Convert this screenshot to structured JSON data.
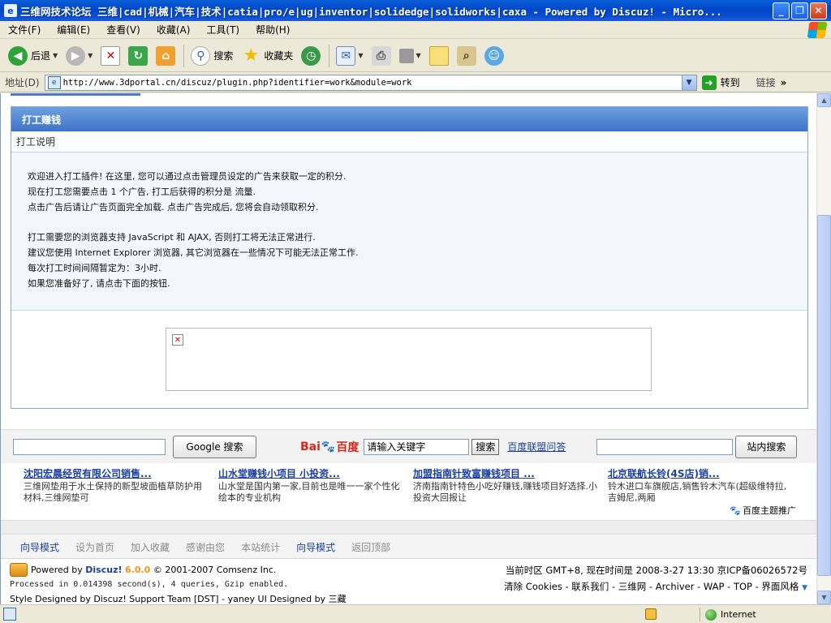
{
  "window": {
    "title": "三维网技术论坛 三维|cad|机械|汽车|技术|catia|pro/e|ug|inventor|solidedge|solidworks|caxa - Powered by Discuz! - Micro..."
  },
  "menu": [
    "文件(F)",
    "编辑(E)",
    "查看(V)",
    "收藏(A)",
    "工具(T)",
    "帮助(H)"
  ],
  "toolbar": {
    "back_label": "后退",
    "search_label": "搜索",
    "favorites_label": "收藏夹"
  },
  "address": {
    "label": "地址(D)",
    "url": "http://www.3dportal.cn/discuz/plugin.php?identifier=work&module=work",
    "go_label": "转到",
    "links_label": "链接"
  },
  "panel": {
    "title": "打工赚钱",
    "subtitle": "打工说明",
    "lines": [
      "欢迎进入打工插件! 在这里, 您可以通过点击管理员设定的广告来获取一定的积分.",
      "现在打工您需要点击  1 个广告, 打工后获得的积分是  流量.",
      "点击广告后请让广告页面完全加载. 点击广告完成后, 您将会自动领取积分."
    ],
    "lines2": [
      "打工需要您的浏览器支持  JavaScript 和  AJAX, 否则打工将无法正常进行.",
      "建议您使用  Internet Explorer 浏览器, 其它浏览器在一些情况下可能无法正常工作.",
      "每次打工时间间隔暂定为：3小时.",
      "如果您准备好了, 请点击下面的按钮."
    ]
  },
  "search": {
    "google_button": "Google 搜索",
    "baidu_logo_left": "Bai",
    "baidu_logo_right": "百度",
    "baidu_input_value": "请输入关键字",
    "baidu_button": "搜索",
    "baidu_link": "百度联盟问答",
    "site_button": "站内搜索"
  },
  "ads": [
    {
      "title": "沈阳宏晨经贸有限公司销售...",
      "desc": "三维网垫用于水土保持的新型坡面植草防护用材料,三维网垫可"
    },
    {
      "title": "山水堂赚钱小项目 小投资...",
      "desc": "山水堂是国内第一家,目前也是唯一一家个性化绘本的专业机构"
    },
    {
      "title": "加盟指南针致富赚钱项目 ...",
      "desc": "济南指南针特色小吃好赚钱,赚钱项目好选择.小投资大回报让"
    },
    {
      "title": "北京联航长铃(4S店)销...",
      "desc": "铃木进口车旗舰店,销售铃木汽车(超级维特拉,吉姆尼,两厢"
    }
  ],
  "baidu_promo": "百度主题推广",
  "nav": [
    "向导模式",
    "设为首页",
    "加入收藏",
    "感谢由您",
    "本站统计",
    "向导模式",
    "返回顶部"
  ],
  "footer": {
    "powered_prefix": "Powered by",
    "discuz": "Discuz!",
    "version": "6.0.0",
    "copyright": "© 2001-2007 Comsenz Inc.",
    "processed": "Processed in 0.014398 second(s), 4 queries, Gzip enabled.",
    "style": "Style Designed by Discuz! Support Team [DST] - yaney UI Designed by 三藏",
    "time": "当前时区  GMT+8, 现在时间是  2008-3-27 13:30 京ICP备06026572号",
    "links": "清除  Cookies - 联系我们 - 三维网 - Archiver - WAP - TOP - 界面风格"
  },
  "status": {
    "zone": "Internet"
  },
  "colors": {
    "header_blue": "#3f74c6",
    "link_blue": "#1a3fa0",
    "baidu_red": "#d8261b",
    "discuz_orange": "#f7941d"
  }
}
